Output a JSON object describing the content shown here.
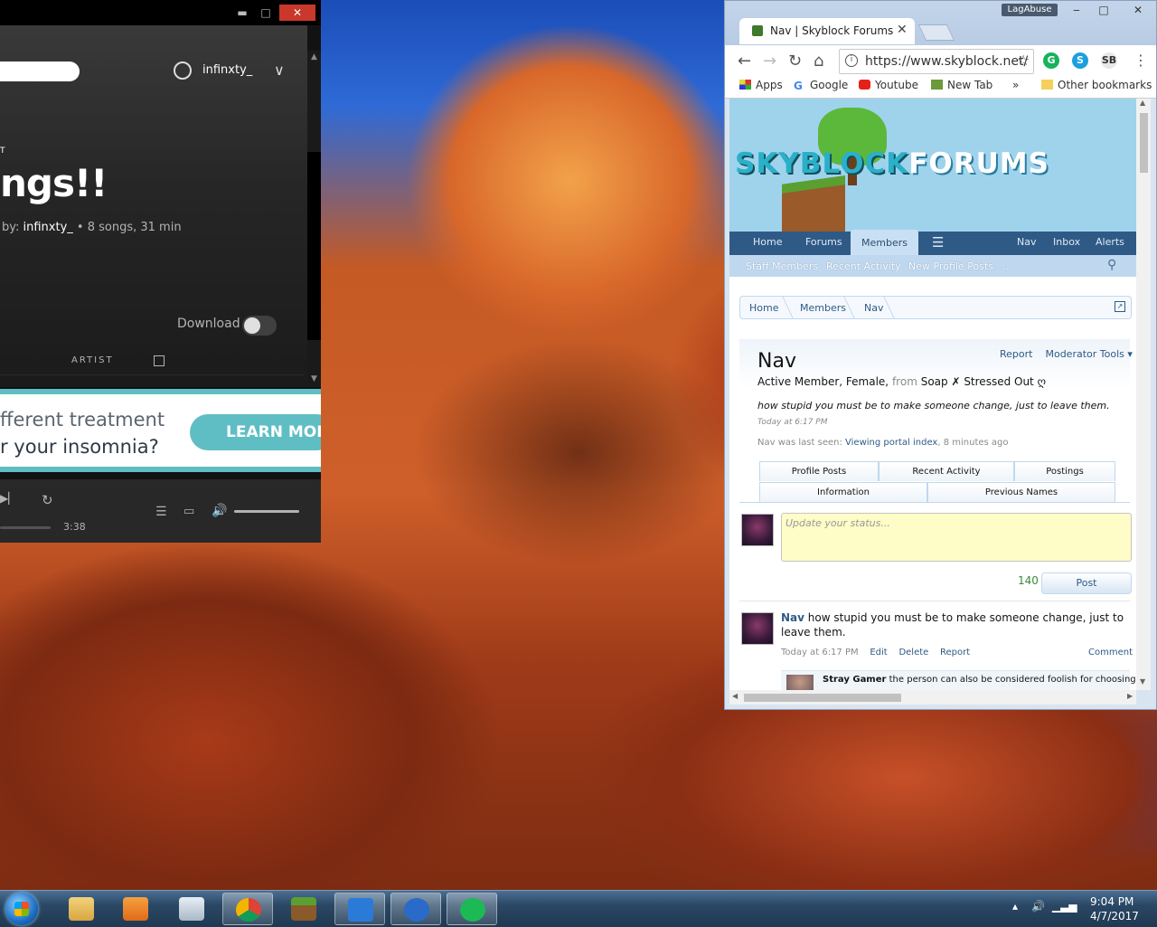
{
  "spotify": {
    "window_controls": {
      "minimize": "▬",
      "maximize": "□",
      "close": "✕"
    },
    "user": "infinxty_",
    "playlist_type": "T",
    "playlist_title": "ngs!!",
    "byline_prefix": "by: ",
    "byline_user": "infinxty_",
    "byline_meta": " • 8 songs, 31 min",
    "download_label": "Download",
    "download_enabled": false,
    "artist_column": "ARTIST",
    "ad_line1": "fferent treatment",
    "ad_line2": "r your insomnia?",
    "ad_button": "LEARN MORE",
    "duration": "3:38",
    "volume_level": 1.0,
    "icons": [
      "user-icon",
      "chevron-down-icon",
      "calendar-icon",
      "next-icon",
      "repeat-icon",
      "queue-icon",
      "devices-icon",
      "volume-icon"
    ]
  },
  "chrome": {
    "profile": "LagAbuse",
    "tab_title": "Nav | Skyblock Forums",
    "url": "https://www.skyblock.net/",
    "extensions": [
      "G",
      "S",
      "SB"
    ],
    "extension_colors": [
      "#15b35a",
      "#1ba0dc",
      "#e8e8e8"
    ],
    "bookmarks": {
      "apps": "Apps",
      "google": "Google",
      "youtube": "Youtube",
      "newtab": "New Tab",
      "more": "»",
      "other": "Other bookmarks"
    }
  },
  "forum": {
    "logo_left": "SKYBLOCK",
    "logo_right": "FORUMS",
    "nav": {
      "home": "Home",
      "forums": "Forums",
      "members": "Members",
      "nav": "Nav",
      "inbox": "Inbox",
      "alerts": "Alerts"
    },
    "subnav": {
      "staff": "Staff Members",
      "recent": "Recent Activity",
      "new_posts": "New Profile Posts",
      "more": "..."
    },
    "breadcrumb": [
      "Home",
      "Members",
      "Nav"
    ],
    "profile": {
      "name": "Nav",
      "report": "Report",
      "moderator_tools": "Moderator Tools",
      "title": "Active Member, Female, ",
      "from_label": "from ",
      "location": "Soap ✗ Stressed Out ღ",
      "status": "how stupid you must be to make someone change, just to leave them.",
      "status_time": "Today at 6:17 PM",
      "last_seen_prefix": "Nav was last seen: ",
      "last_seen_activity": "Viewing portal index",
      "last_seen_time": ", 8 minutes ago"
    },
    "tabs": [
      "Profile Posts",
      "Recent Activity",
      "Postings",
      "Information",
      "Previous Names"
    ],
    "status_placeholder": "Update your status...",
    "char_count": "140",
    "post_button": "Post",
    "message": {
      "author": "Nav",
      "text": " how stupid you must be to make someone change, just to leave them.",
      "time": "Today at 6:17 PM",
      "edit": "Edit",
      "delete": "Delete",
      "report": "Report",
      "comment": "Comment"
    },
    "comment": {
      "author": "Stray Gamer",
      "text": " the person can also be considered foolish for choosing"
    }
  },
  "taskbar": {
    "items": [
      "windows-explorer",
      "media-player",
      "calculator",
      "chrome",
      "minecraft",
      "app-blue-1",
      "app-blue-2",
      "spotify"
    ],
    "time": "9:04 PM",
    "date": "4/7/2017"
  }
}
